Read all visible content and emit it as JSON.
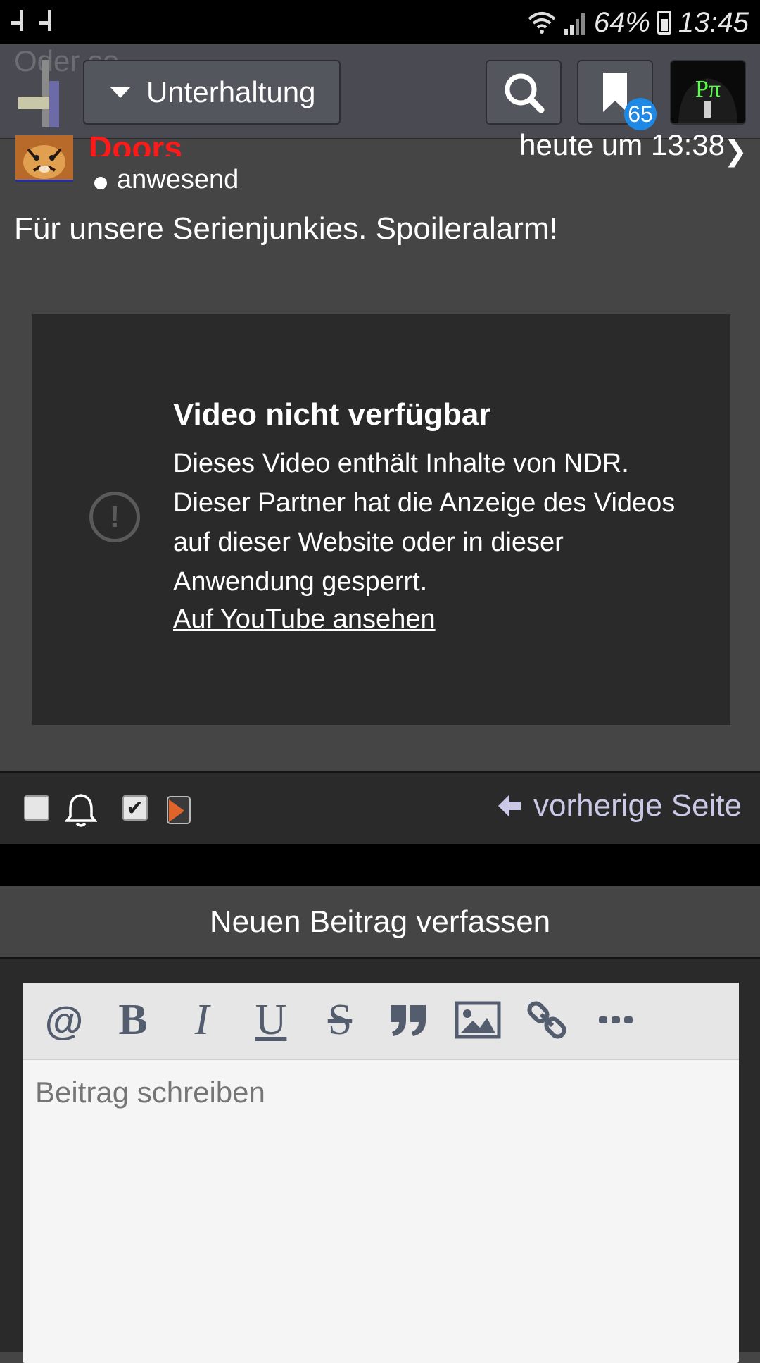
{
  "status_bar": {
    "battery": "64%",
    "time": "13:45"
  },
  "header": {
    "ghost_title": "Oder so",
    "category": "Unterhaltung",
    "bookmark_count": "65",
    "avatar_text": "Pπ"
  },
  "post": {
    "author": "Doors",
    "time": "heute um 13:38",
    "status": "anwesend",
    "text": "Für unsere Serienjunkies. Spoileralarm!"
  },
  "video": {
    "title": "Video nicht verfügbar",
    "message": "Dieses Video enthält Inhalte von NDR. Dieser Partner hat die Anzeige des Videos auf dieser Website oder in dieser Anwendung gesperrt.",
    "link": "Auf YouTube ansehen"
  },
  "footer": {
    "prev_page": "vorherige Seite"
  },
  "compose": {
    "title": "Neuen Beitrag verfassen",
    "placeholder": "Beitrag schreiben",
    "toolbar": {
      "mention": "@",
      "bold": "B",
      "italic": "I",
      "underline": "U",
      "strike": "S"
    }
  },
  "colors": {
    "author": "#ff1a1a",
    "badge": "#1e88e5",
    "link_accent": "#c9c8e6",
    "toolbar_icon": "#545d6e"
  }
}
